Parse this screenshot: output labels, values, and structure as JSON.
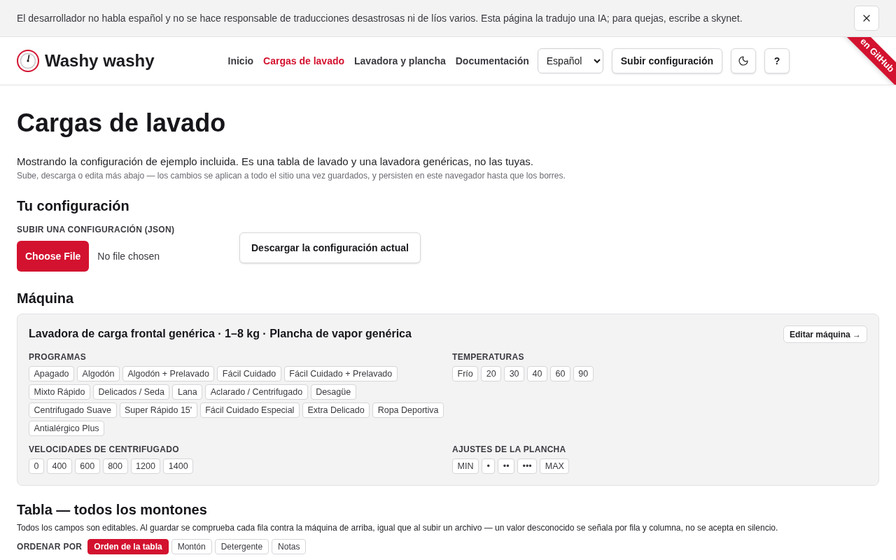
{
  "banner": {
    "message": "El desarrollador no habla español y no se hace responsable de traducciones desastrosas ni de líos varios. Esta página la tradujo una IA; para quejas, escribe a skynet."
  },
  "header": {
    "brand": "Washy washy",
    "nav": [
      {
        "label": "Inicio",
        "selected": false
      },
      {
        "label": "Cargas de lavado",
        "selected": true
      },
      {
        "label": "Lavadora y plancha",
        "selected": false
      },
      {
        "label": "Documentación",
        "selected": false
      }
    ],
    "language": "Español",
    "upload_button": "Subir configuración",
    "help_button": "?",
    "ribbon": "en GitHub"
  },
  "intro": {
    "title": "Cargas de lavado",
    "lead": "Mostrando la configuración de ejemplo incluida. Es una tabla de lavado y una lavadora genéricas, no las tuyas.",
    "note": "Sube, descarga o edita más abajo — los cambios se aplican a todo el sitio una vez guardados, y persisten en este navegador hasta que los borres."
  },
  "config": {
    "heading": "Tu configuración",
    "upload_label": "SUBIR UNA CONFIGURACIÓN (JSON)",
    "file_button": "Choose File",
    "file_status": "No file chosen",
    "download_button": "Descargar la configuración actual"
  },
  "machine": {
    "heading": "Máquina",
    "title": "Lavadora de carga frontal genérica · 1–8 kg · Plancha de vapor genérica",
    "edit_button": "Editar máquina →",
    "groups": [
      {
        "label": "PROGRAMAS",
        "options": [
          "Apagado",
          "Algodón",
          "Algodón + Prelavado",
          "Fácil Cuidado",
          "Fácil Cuidado + Prelavado",
          "Mixto Rápido",
          "Delicados / Seda",
          "Lana",
          "Aclarado / Centrifugado",
          "Desagüe",
          "Centrifugado Suave",
          "Super Rápido 15'",
          "Fácil Cuidado Especial",
          "Extra Delicado",
          "Ropa Deportiva",
          "Antialérgico Plus"
        ]
      },
      {
        "label": "TEMPERATURAS",
        "options": [
          "Frío",
          "20",
          "30",
          "40",
          "60",
          "90"
        ]
      },
      {
        "label": "VELOCIDADES DE CENTRIFUGADO",
        "options": [
          "0",
          "400",
          "600",
          "800",
          "1200",
          "1400"
        ]
      },
      {
        "label": "AJUSTES DE LA PLANCHA",
        "options": [
          "MIN",
          "•",
          "••",
          "•••",
          "MAX"
        ]
      }
    ]
  },
  "table": {
    "heading": "Tabla — todos los montones",
    "description": "Todos los campos son editables. Al guardar se comprueba cada fila contra la máquina de arriba, igual que al subir un archivo — un valor desconocido se señala por fila y columna, no se acepta en silencio.",
    "sort_label": "ORDENAR POR",
    "sort_options": [
      {
        "label": "Orden de la tabla",
        "selected": true
      },
      {
        "label": "Montón",
        "selected": false
      },
      {
        "label": "Detergente",
        "selected": false
      },
      {
        "label": "Notas",
        "selected": false
      }
    ]
  }
}
